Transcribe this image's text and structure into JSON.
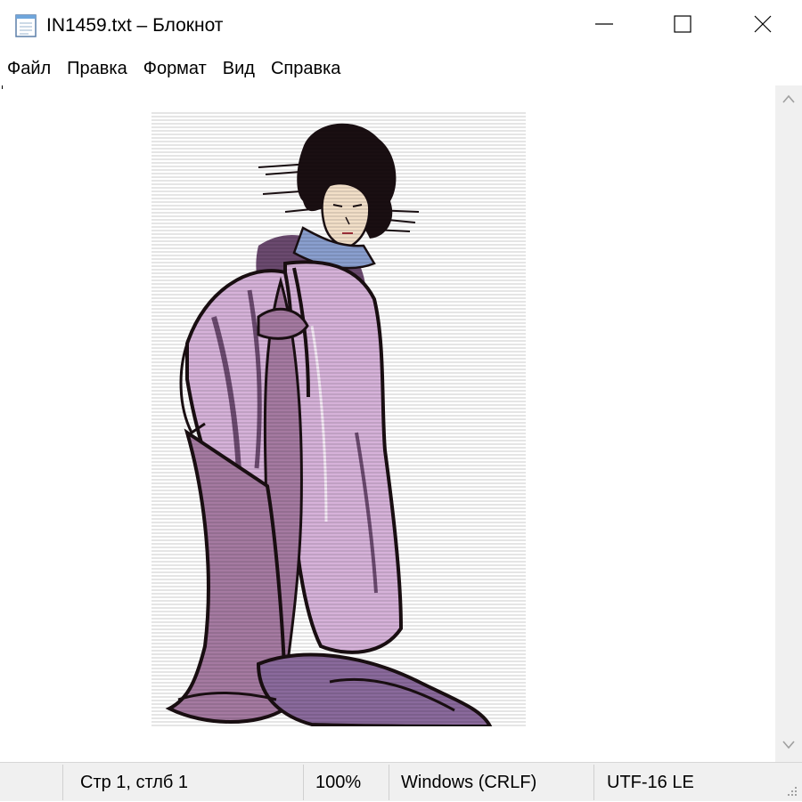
{
  "window": {
    "title": "IN1459.txt – Блокнот",
    "icon": "notepad-icon"
  },
  "controls": {
    "minimize_icon": "minimize-icon",
    "maximize_icon": "maximize-icon",
    "close_icon": "close-icon"
  },
  "menu": {
    "items": [
      {
        "label": "Файл"
      },
      {
        "label": "Правка"
      },
      {
        "label": "Формат"
      },
      {
        "label": "Вид"
      },
      {
        "label": "Справка"
      }
    ]
  },
  "content": {
    "image": "geisha-illustration"
  },
  "status": {
    "position": "Стр 1, стлб 1",
    "zoom": "100%",
    "line_ending": "Windows (CRLF)",
    "encoding": "UTF-16 LE"
  },
  "colors": {
    "kimono_light": "#d6b2d9",
    "kimono_mid": "#a57aa1",
    "kimono_dark": "#6b4a6f",
    "collar_blue": "#8a9fcf",
    "skin": "#f2dfc8",
    "outline": "#1a0f12",
    "statusbar_bg": "#f0f0f0"
  }
}
